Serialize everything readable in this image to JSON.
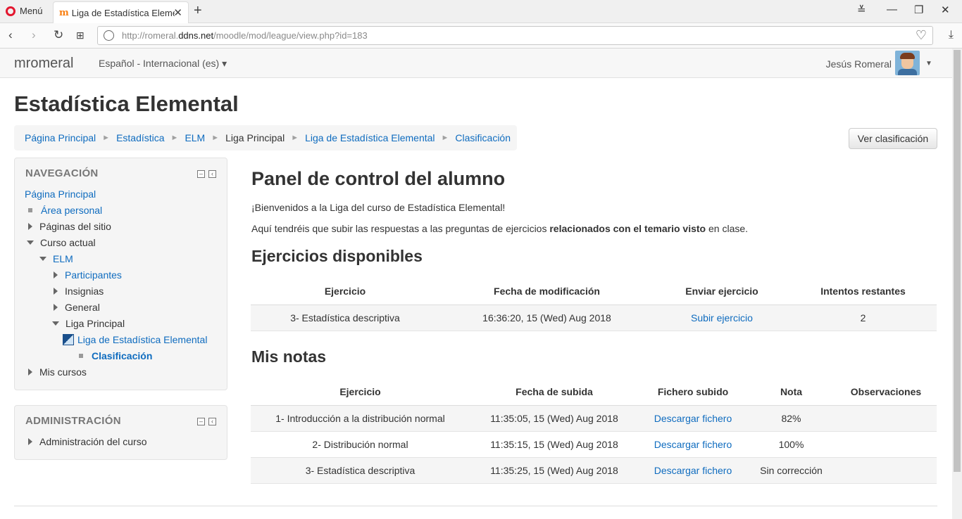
{
  "browser": {
    "menu_label": "Menú",
    "tab_title": "Liga de Estadística Elemen",
    "url_prefix": "http://romeral.",
    "url_host": "ddns.net",
    "url_path": "/moodle/mod/league/view.php?id=183"
  },
  "navbar": {
    "brand": "mromeral",
    "language": "Español - Internacional (es) ▾",
    "user_name": "Jesús Romeral"
  },
  "page": {
    "title": "Estadística Elemental",
    "view_ranking_button": "Ver clasificación"
  },
  "breadcrumb": [
    "Página Principal",
    "Estadística",
    "ELM",
    "Liga Principal",
    "Liga de Estadística Elemental",
    "Clasificación"
  ],
  "navigation_block": {
    "title": "NAVEGACIÓN",
    "items": [
      "Página Principal",
      "Área personal",
      "Páginas del sitio",
      "Curso actual",
      "ELM",
      "Participantes",
      "Insignias",
      "General",
      "Liga Principal",
      "Liga de Estadística Elemental",
      "Clasificación",
      "Mis cursos"
    ]
  },
  "admin_block": {
    "title": "ADMINISTRACIÓN",
    "items": [
      "Administración del curso"
    ]
  },
  "main": {
    "heading": "Panel de control del alumno",
    "welcome": "¡Bienvenidos a la Liga del curso de Estadística Elemental!",
    "instructions_before": "Aquí tendréis que subir las respuestas a las preguntas de ejercicios ",
    "instructions_bold": "relacionados con el temario visto",
    "instructions_after": " en clase.",
    "available_heading": "Ejercicios disponibles",
    "available_headers": [
      "Ejercicio",
      "Fecha de modificación",
      "Enviar ejercicio",
      "Intentos restantes"
    ],
    "available_rows": [
      {
        "exercise": "3- Estadística descriptiva",
        "modified": "16:36:20, 15 (Wed) Aug 2018",
        "action": "Subir ejercicio",
        "attempts": "2"
      }
    ],
    "grades_heading": "Mis notas",
    "grades_headers": [
      "Ejercicio",
      "Fecha de subida",
      "Fichero subido",
      "Nota",
      "Observaciones"
    ],
    "grades_rows": [
      {
        "exercise": "1- Introducción a la distribución normal",
        "uploaded": "11:35:05, 15 (Wed) Aug 2018",
        "file": "Descargar fichero",
        "grade": "82%",
        "notes": ""
      },
      {
        "exercise": "2- Distribución normal",
        "uploaded": "11:35:15, 15 (Wed) Aug 2018",
        "file": "Descargar fichero",
        "grade": "100%",
        "notes": ""
      },
      {
        "exercise": "3- Estadística descriptiva",
        "uploaded": "11:35:25, 15 (Wed) Aug 2018",
        "file": "Descargar fichero",
        "grade": "Sin corrección",
        "notes": ""
      }
    ]
  }
}
